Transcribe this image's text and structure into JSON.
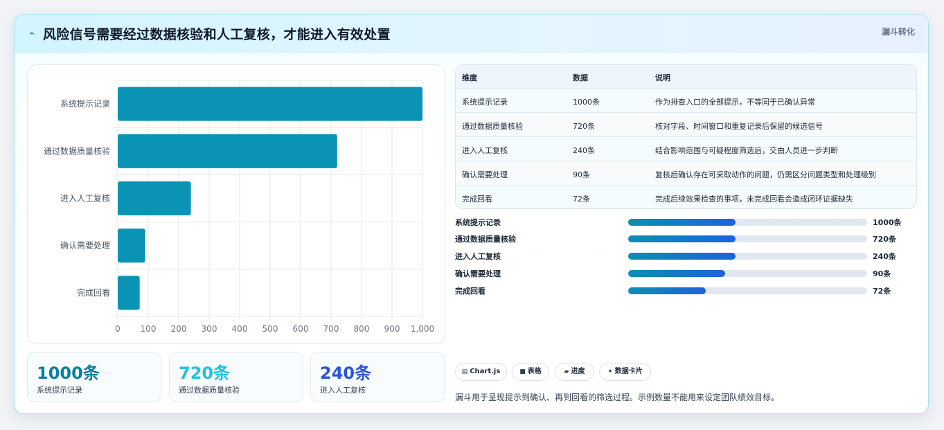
{
  "header": {
    "icon": "chart-spark-icon",
    "icon_glyph": "⌁",
    "title": "风险信号需要经过数据核验和人工复核，才能进入有效处置",
    "tag": "漏斗转化"
  },
  "chart_data": {
    "type": "bar",
    "orientation": "horizontal",
    "categories": [
      "系统提示记录",
      "通过数据质量核验",
      "进入人工复核",
      "确认需要处理",
      "完成回看"
    ],
    "values": [
      1000,
      720,
      240,
      90,
      72
    ],
    "title": "",
    "xlabel": "",
    "ylabel": "",
    "xlim": [
      0,
      1000
    ],
    "x_ticks": [
      "0",
      "100",
      "200",
      "300",
      "400",
      "500",
      "600",
      "700",
      "800",
      "900",
      "1,000"
    ],
    "grid": true,
    "legend": "none",
    "bar_color": "#0a93b5"
  },
  "stats": [
    {
      "value": "1000条",
      "label": "系统提示记录",
      "color": "#0b7fa0"
    },
    {
      "value": "720条",
      "label": "通过数据质量核验",
      "color": "#22c1e0"
    },
    {
      "value": "240条",
      "label": "进入人工复核",
      "color": "#2856d6"
    }
  ],
  "table": {
    "headers": [
      "维度",
      "数据",
      "说明"
    ],
    "rows": [
      [
        "系统提示记录",
        "1000条",
        "作为排查入口的全部提示，不等同于已确认异常"
      ],
      [
        "通过数据质量核验",
        "720条",
        "核对字段、时间窗口和重复记录后保留的候选信号"
      ],
      [
        "进入人工复核",
        "240条",
        "结合影响范围与可疑程度筛选后，交由人员进一步判断"
      ],
      [
        "确认需要处理",
        "90条",
        "复核后确认存在可采取动作的问题，仍需区分问题类型和处理级别"
      ],
      [
        "完成回看",
        "72条",
        "完成后续效果检查的事项，未完成回看会造成闭环证据缺失"
      ]
    ]
  },
  "progress": [
    {
      "label": "系统提示记录",
      "value": "1000条",
      "fill": 0.45
    },
    {
      "label": "通过数据质量核验",
      "value": "720条",
      "fill": 0.45
    },
    {
      "label": "进入人工复核",
      "value": "240条",
      "fill": 0.45
    },
    {
      "label": "确认需要处理",
      "value": "90条",
      "fill": 0.405
    },
    {
      "label": "完成回看",
      "value": "72条",
      "fill": 0.324
    }
  ],
  "pills": [
    {
      "icon": "chart-icon",
      "glyph": "▤",
      "label": "Chart.js"
    },
    {
      "icon": "table-icon",
      "glyph": "■",
      "label": "表格"
    },
    {
      "icon": "progress-icon",
      "glyph": "▰",
      "label": "进度"
    },
    {
      "icon": "card-icon",
      "glyph": "✦",
      "label": "数据卡片"
    }
  ],
  "note": "漏斗用于呈现提示到确认、再到回看的筛选过程。示例数量不能用来设定团队绩效目标。"
}
